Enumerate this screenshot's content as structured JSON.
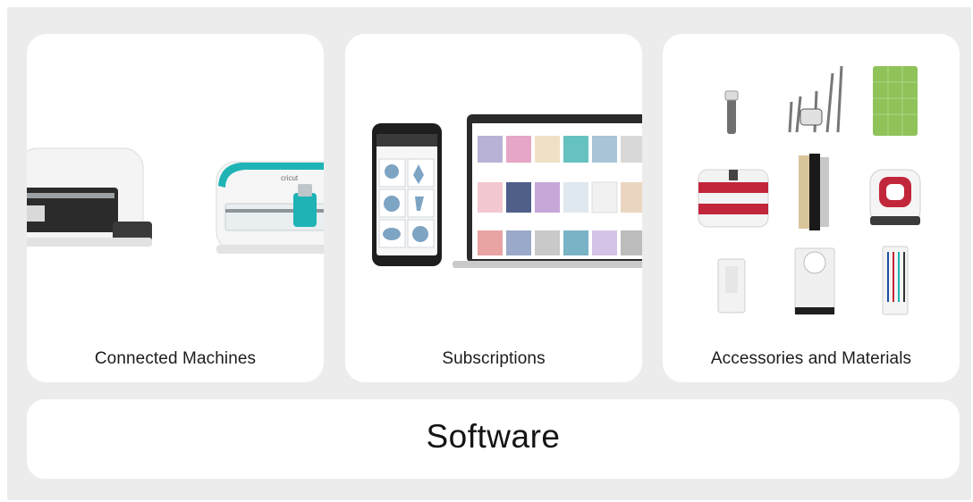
{
  "cards": [
    {
      "label": "Connected Machines",
      "image": "cutting-machines"
    },
    {
      "label": "Subscriptions",
      "image": "phone-and-laptop-design-library"
    },
    {
      "label": "Accessories and Materials",
      "image": "tools-and-supplies-grid"
    }
  ],
  "software": {
    "label": "Software"
  },
  "device_text": {
    "brand": "cricut"
  },
  "colors": {
    "background": "#ececec",
    "card": "#ffffff",
    "text": "#1c1c1c",
    "teal_accent": "#1fb3b6",
    "red_accent": "#c2263a",
    "mat_green": "#8fc35a"
  }
}
